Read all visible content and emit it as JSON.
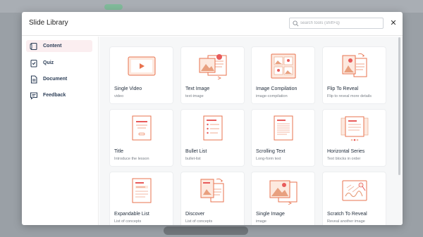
{
  "modal": {
    "title": "Slide Library",
    "search_placeholder": "search tools (shift+q)",
    "close_icon": "close-icon"
  },
  "sidebar": {
    "items": [
      {
        "label": "Content",
        "icon": "content-icon",
        "active": true
      },
      {
        "label": "Quiz",
        "icon": "quiz-icon",
        "active": false
      },
      {
        "label": "Document",
        "icon": "document-icon",
        "active": false
      },
      {
        "label": "Feedback",
        "icon": "feedback-icon",
        "active": false
      }
    ]
  },
  "cards": [
    {
      "title": "Single Video",
      "subtitle": "video",
      "icon": "video-thumb-icon"
    },
    {
      "title": "Text Image",
      "subtitle": "text-image",
      "icon": "text-image-thumb-icon"
    },
    {
      "title": "Image Compilation",
      "subtitle": "image-compilation",
      "icon": "image-compilation-thumb-icon"
    },
    {
      "title": "Flip To Reveal",
      "subtitle": "Flip to reveal more details",
      "icon": "flip-thumb-icon"
    },
    {
      "title": "Title",
      "subtitle": "Introduce the lesson",
      "icon": "title-thumb-icon"
    },
    {
      "title": "Bullet List",
      "subtitle": "bullet-list",
      "icon": "bullet-list-thumb-icon"
    },
    {
      "title": "Scrolling Text",
      "subtitle": "Long-form text",
      "icon": "scrolling-text-thumb-icon"
    },
    {
      "title": "Horizontal Series",
      "subtitle": "Text blocks in order",
      "icon": "horizontal-series-thumb-icon"
    },
    {
      "title": "Expandable List",
      "subtitle": "List of concepts",
      "icon": "expandable-list-thumb-icon"
    },
    {
      "title": "Discover",
      "subtitle": "List of concepts",
      "icon": "discover-thumb-icon"
    },
    {
      "title": "Single Image",
      "subtitle": "image",
      "icon": "single-image-thumb-icon"
    },
    {
      "title": "Scratch To Reveal",
      "subtitle": "Reveal another image",
      "icon": "scratch-thumb-icon"
    }
  ],
  "colors": {
    "accent": "#e8734f",
    "accent_light": "#fde9df",
    "active_bg": "#fbeef0",
    "nav_text": "#2c3e57"
  }
}
